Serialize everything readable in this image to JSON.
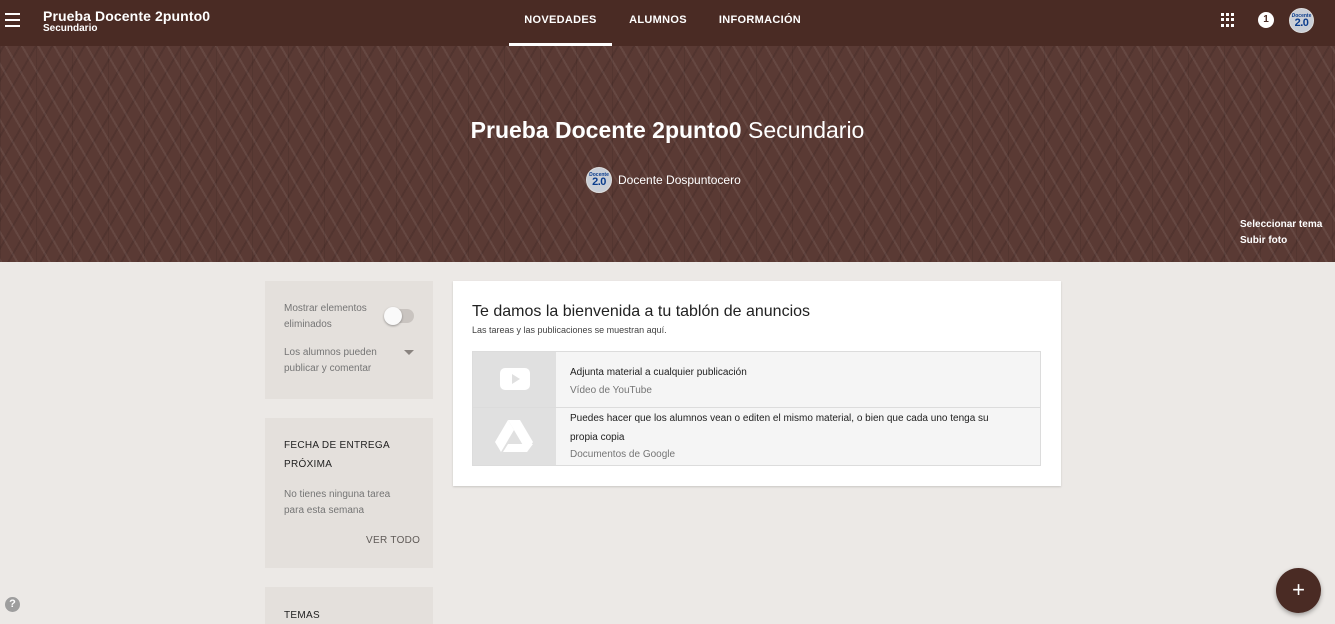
{
  "header": {
    "class_name": "Prueba Docente 2punto0",
    "section": "Secundario",
    "tabs": [
      {
        "label": "NOVEDADES",
        "active": true
      },
      {
        "label": "ALUMNOS",
        "active": false
      },
      {
        "label": "INFORMACIÓN",
        "active": false
      }
    ],
    "notification_count": "1",
    "avatar_logo_top": "Docente",
    "avatar_logo_main": "2.0",
    "icons": [
      "menu-icon",
      "apps-icon"
    ]
  },
  "banner": {
    "title_bold": "Prueba Docente 2punto0",
    "title_light": "Secundario",
    "teacher_name": "Docente Dospuntocero",
    "select_theme": "Seleccionar tema",
    "upload_photo": "Subir foto"
  },
  "sidebar": {
    "show_deleted_label": "Mostrar elementos eliminados",
    "show_deleted_line1": "Mostrar elementos",
    "show_deleted_line2": "eliminados",
    "show_deleted_on": false,
    "students_post_line1": "Los alumnos pueden",
    "students_post_line2": "publicar y comentar",
    "due_heading_line1": "FECHA DE ENTREGA",
    "due_heading_line2": "PRÓXIMA",
    "due_empty_line1": "No tienes ninguna tarea",
    "due_empty_line2": "para esta semana",
    "see_all": "VER TODO",
    "topics_heading": "TEMAS"
  },
  "welcome": {
    "title": "Te damos la bienvenida a tu tablón de anuncios",
    "subtitle": "Las tareas y las publicaciones se muestran aquí.",
    "tips": [
      {
        "title": "Adjunta material a cualquier publicación",
        "source": "Vídeo de YouTube",
        "icon": "youtube-icon"
      },
      {
        "title_line1": "Puedes hacer que los alumnos vean o editen el mismo material, o bien que cada uno tenga su",
        "title_line2": "propia copia",
        "source": "Documentos de Google",
        "icon": "google-drive-icon"
      }
    ]
  },
  "footer": {
    "help": "?",
    "fab": "+"
  },
  "colors": {
    "brand": "#4a2b24",
    "background": "#ece9e6",
    "side_card": "#e4e0dc"
  }
}
